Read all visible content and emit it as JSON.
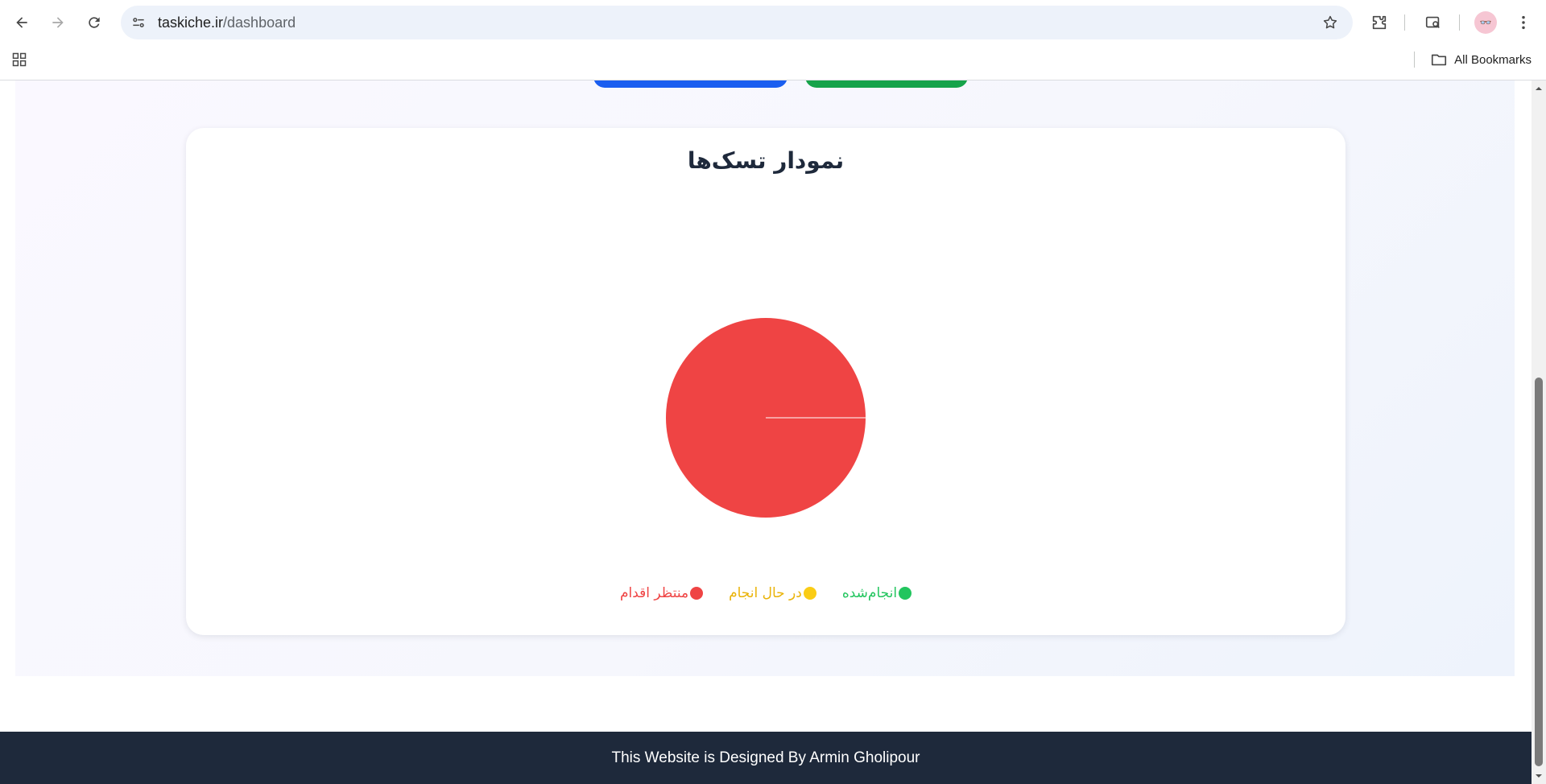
{
  "browser": {
    "url_host": "taskiche.ir",
    "url_path": "/dashboard",
    "bookmarks_label": "All Bookmarks",
    "avatar_glyph": "👓"
  },
  "card": {
    "title": "نمودار تسک‌ها"
  },
  "chart_data": {
    "type": "pie",
    "title": "نمودار تسک‌ها",
    "categories": [
      "انجام‌شده",
      "در حال انجام",
      "منتظر اقدام"
    ],
    "values": [
      0,
      0,
      100
    ],
    "colors": [
      "#22c55e",
      "#facc15",
      "#ef4444"
    ],
    "legend_position": "bottom"
  },
  "legend": {
    "done": "انجام‌شده",
    "in_progress": "در حال انجام",
    "pending": "منتظر اقدام"
  },
  "colors": {
    "done": "#22c55e",
    "in_progress": "#facc15",
    "pending": "#ef4444",
    "primary_blue": "#1a5ef0",
    "primary_green": "#16a34a",
    "footer_bg": "#1e293b"
  },
  "footer": {
    "text": "This Website is Designed By Armin Gholipour"
  }
}
